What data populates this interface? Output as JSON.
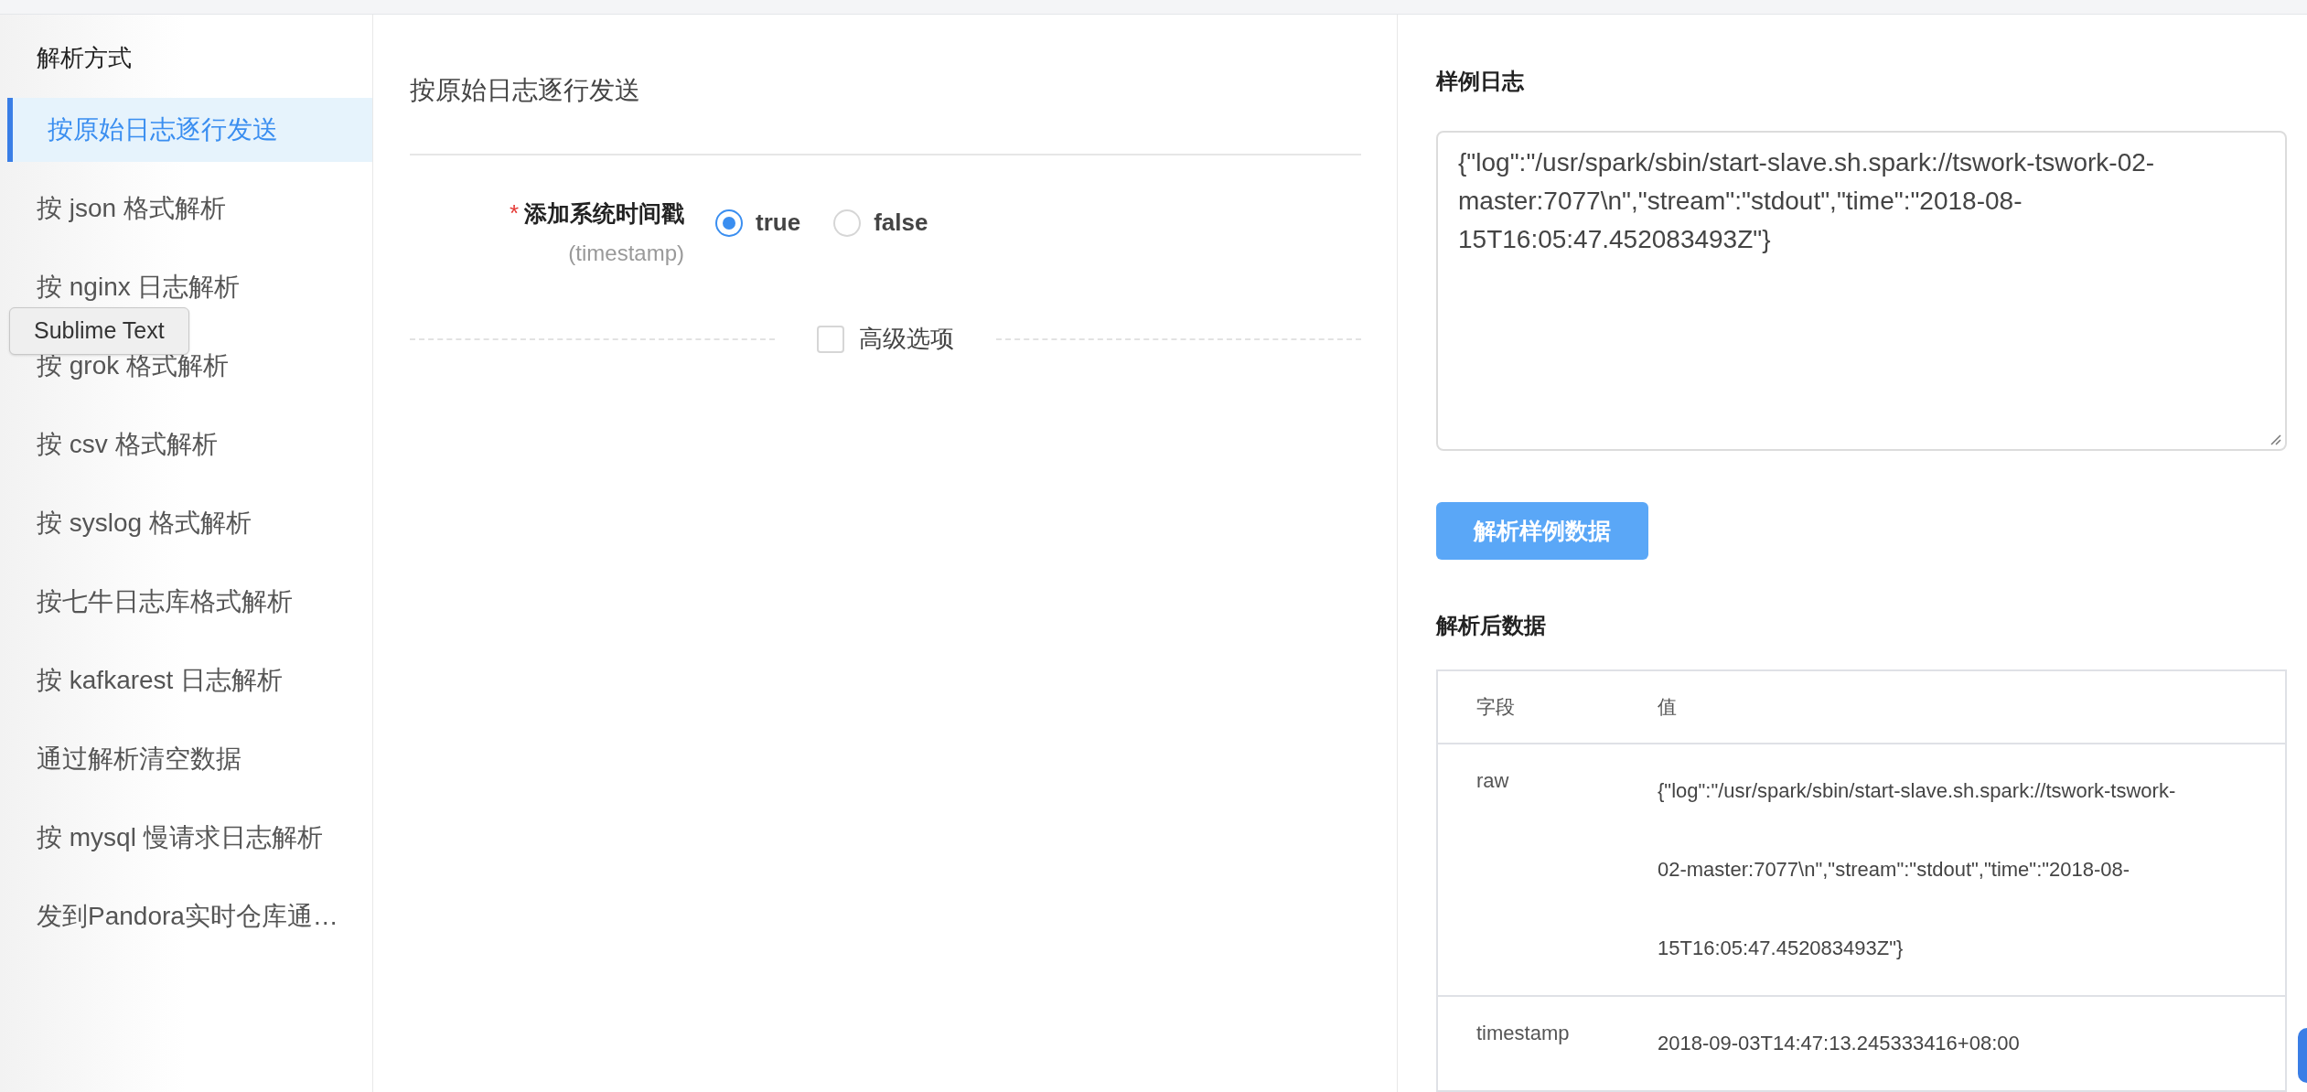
{
  "sidebar": {
    "title": "解析方式",
    "items": [
      {
        "label": "按原始日志逐行发送",
        "selected": true
      },
      {
        "label": "按 json 格式解析",
        "selected": false
      },
      {
        "label": "按 nginx 日志解析",
        "selected": false
      },
      {
        "label": "按 grok 格式解析",
        "selected": false
      },
      {
        "label": "按 csv 格式解析",
        "selected": false
      },
      {
        "label": "按 syslog 格式解析",
        "selected": false
      },
      {
        "label": "按七牛日志库格式解析",
        "selected": false
      },
      {
        "label": "按 kafkarest 日志解析",
        "selected": false
      },
      {
        "label": "通过解析清空数据",
        "selected": false
      },
      {
        "label": "按 mysql 慢请求日志解析",
        "selected": false
      },
      {
        "label": "发到Pandora实时仓库通…",
        "selected": false
      }
    ]
  },
  "tooltip": "Sublime Text",
  "form": {
    "title": "按原始日志逐行发送",
    "field": {
      "required_mark": "*",
      "label": "添加系统时间戳",
      "sublabel": "(timestamp)",
      "options": [
        {
          "label": "true",
          "selected": true
        },
        {
          "label": "false",
          "selected": false
        }
      ]
    },
    "advanced": {
      "label": "高级选项",
      "checked": false
    }
  },
  "sample": {
    "title": "样例日志",
    "value": "{\"log\":\"/usr/spark/sbin/start-slave.sh.spark://tswork-tswork-02-master:7077\\n\",\"stream\":\"stdout\",\"time\":\"2018-08-15T16:05:47.452083493Z\"}",
    "button": "解析样例数据"
  },
  "result": {
    "title": "解析后数据",
    "columns": [
      "字段",
      "值"
    ],
    "rows": [
      {
        "field": "raw",
        "value": "{\"log\":\"/usr/spark/sbin/start-slave.sh.spark://tswork-tswork-02-master:7077\\n\",\"stream\":\"stdout\",\"time\":\"2018-08-15T16:05:47.452083493Z\"}"
      },
      {
        "field": "timestamp",
        "value": "2018-09-03T14:47:13.245333416+08:00"
      }
    ]
  }
}
